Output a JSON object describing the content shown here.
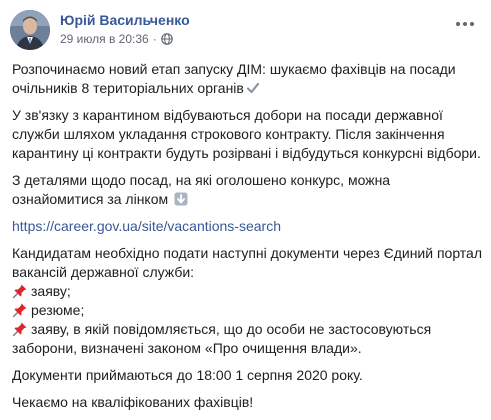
{
  "post": {
    "author": "Юрій Васильченко",
    "timestamp": "29 июля в 20:36",
    "separator": "·",
    "privacy_icon": "globe-icon",
    "menu_icon": "more-options-icon",
    "paragraphs": {
      "p1": "Розпочинаємо новий етап запуску ДІМ: шукаємо фахівців на посади очільників 8 територіальних органів",
      "p1_emoji": "check-mark-icon",
      "p2": "У зв'язку з карантином відбуваються добори на посади державної служби шляхом укладання строкового контракту. Після закінчення карантину ці контракти будуть розірвані і відбудуться конкурсні відбори.",
      "p3": "З деталями щодо посад, на які оголошено конкурс, можна ознайомитися за лінком",
      "p3_emoji": "down-arrow-icon",
      "link": "https://career.gov.ua/site/vacantions-search",
      "p4": "Кандидатам необхідно подати наступні документи через Єдиний портал вакансій державної служби:",
      "list": [
        "заяву;",
        "резюме;",
        "заяву, в якій повідомляється, що до особи не застосовуються заборони, визначені законом «Про очищення влади»."
      ],
      "list_icon": "pushpin-icon",
      "p5": "Документи приймаються до 18:00 1 серпня 2020 року.",
      "p6": "Чекаємо на кваліфікованих фахівців!"
    },
    "colors": {
      "author": "#385898",
      "link": "#385898",
      "meta": "#616770",
      "text": "#1c1e21",
      "pin": "#e0242c"
    }
  }
}
